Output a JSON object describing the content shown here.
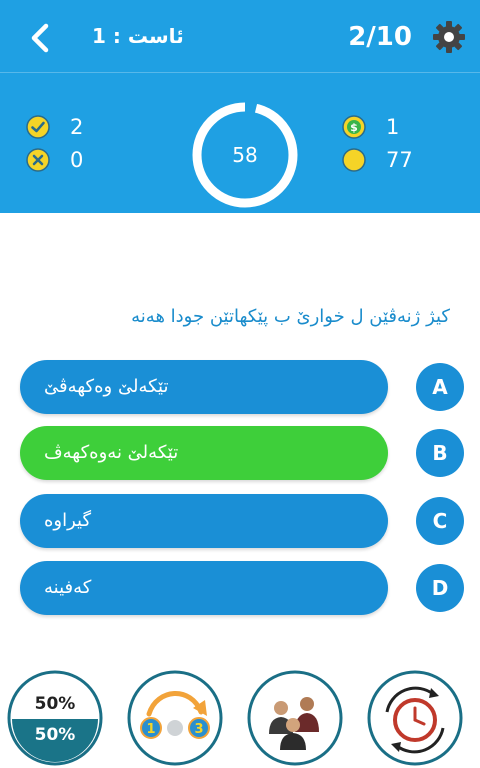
{
  "header": {
    "level_label": "ئاست : 1",
    "progress": "2/10"
  },
  "stats": {
    "correct_count": "2",
    "wrong_count": "0",
    "timer_seconds": "58",
    "coins": "1",
    "points": "77"
  },
  "question": {
    "text": "کیژ ژنەڤێن ل خوارێ ب پێکهاتێن جودا هەنە"
  },
  "options": [
    {
      "letter": "A",
      "text": "تێکەلێ وەکهەڤێ",
      "state": "default"
    },
    {
      "letter": "B",
      "text": "تێکەلێ نەوەکهەڤ",
      "state": "selected-correct"
    },
    {
      "letter": "C",
      "text": "گیراوە",
      "state": "default"
    },
    {
      "letter": "D",
      "text": "کەفینە",
      "state": "default"
    }
  ],
  "lifelines": {
    "fifty_top": "50%",
    "fifty_bottom": "50%",
    "skip_left_number": "1",
    "skip_right_number": "3"
  },
  "colors": {
    "header_blue": "#1fa0e3",
    "option_blue": "#1a8fd6",
    "option_green": "#3ecf3a",
    "question_text": "#1a8ccc"
  }
}
